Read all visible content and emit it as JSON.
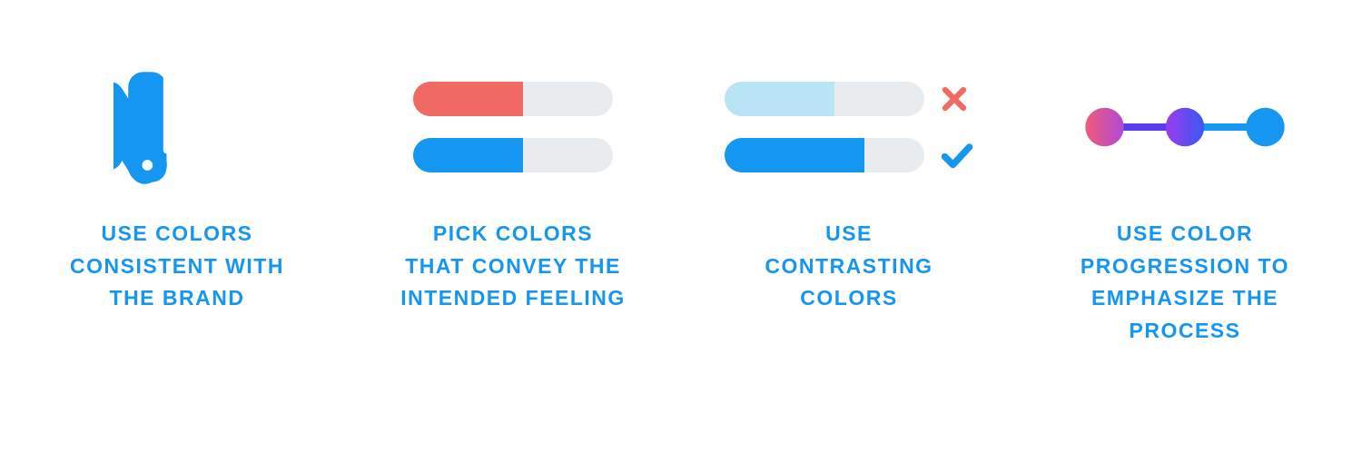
{
  "cards": [
    {
      "caption": "USE COLORS\nCONSISTENT WITH\nTHE BRAND"
    },
    {
      "caption": "PICK COLORS\nTHAT CONVEY THE\nINTENDED FEELING"
    },
    {
      "caption": "USE\nCONTRASTING\nCOLORS"
    },
    {
      "caption": "USE COLOR\nPROGRESSION TO\nEMPHASIZE THE\nPROCESS"
    }
  ],
  "colors": {
    "primary": "#1596f0",
    "red": "#f06a63",
    "grey": "#e9ecef",
    "light_blue": "#b8e4f5",
    "gradient_start": "#f05a7a",
    "gradient_mid": "#5a3cf0",
    "gradient_end": "#1596f0"
  }
}
